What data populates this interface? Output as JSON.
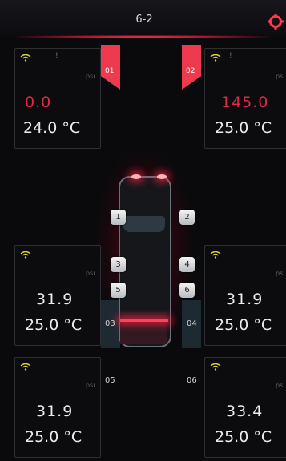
{
  "header": {
    "title": "6-2",
    "settings_icon": "gear-icon"
  },
  "colors": {
    "alarm": "#e02848",
    "accent": "#ee3a4e",
    "normal": "#ececec"
  },
  "tires": [
    {
      "id": "01",
      "pressure": "0.0",
      "unit": "psi",
      "temp": "24.0 °C",
      "alarm": true,
      "alert_mark": "!"
    },
    {
      "id": "02",
      "pressure": "145.0",
      "unit": "psi",
      "temp": "25.0 °C",
      "alarm": true,
      "alert_mark": "!"
    },
    {
      "id": "03",
      "pressure": "31.9",
      "unit": "psi",
      "temp": "25.0 °C",
      "alarm": false
    },
    {
      "id": "04",
      "pressure": "31.9",
      "unit": "psi",
      "temp": "25.0 °C",
      "alarm": false
    },
    {
      "id": "05",
      "pressure": "31.9",
      "unit": "psi",
      "temp": "25.0 °C",
      "alarm": false
    },
    {
      "id": "06",
      "pressure": "33.4",
      "unit": "psi",
      "temp": "25.0 °C",
      "alarm": false
    }
  ],
  "wheel_buttons": [
    "1",
    "2",
    "3",
    "4",
    "5",
    "6"
  ]
}
